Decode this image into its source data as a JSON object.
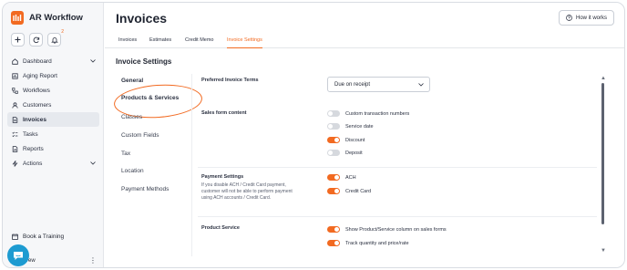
{
  "app": {
    "name": "AR Workflow",
    "notification_count": "2"
  },
  "sidebar": {
    "items": [
      {
        "label": "Dashboard",
        "icon": "home-icon",
        "expandable": true
      },
      {
        "label": "Aging Report",
        "icon": "report-icon"
      },
      {
        "label": "Workflows",
        "icon": "workflow-icon"
      },
      {
        "label": "Customers",
        "icon": "user-icon"
      },
      {
        "label": "Invoices",
        "icon": "document-icon",
        "active": true
      },
      {
        "label": "Tasks",
        "icon": "tasks-icon"
      },
      {
        "label": "Reports",
        "icon": "chart-icon"
      },
      {
        "label": "Actions",
        "icon": "bolt-icon",
        "expandable": true
      }
    ],
    "book_training": "Book a Training",
    "user_partial": "rew"
  },
  "header": {
    "title": "Invoices",
    "how_it_works": "How it works"
  },
  "tabs": [
    {
      "label": "Invoices"
    },
    {
      "label": "Estimates"
    },
    {
      "label": "Credit Memo"
    },
    {
      "label": "Invoice Settings",
      "active": true
    }
  ],
  "settings": {
    "title": "Invoice Settings",
    "subnav": [
      "General",
      "Products & Services",
      "Classes",
      "Custom Fields",
      "Tax",
      "Location",
      "Payment Methods"
    ],
    "preferred_terms_label": "Preferred Invoice Terms",
    "preferred_terms_value": "Due on receipt",
    "sales_form_label": "Sales form content",
    "sales_form_toggles": [
      {
        "label": "Custom transaction numbers",
        "on": false
      },
      {
        "label": "Service date",
        "on": false
      },
      {
        "label": "Discount",
        "on": true
      },
      {
        "label": "Deposit",
        "on": false
      }
    ],
    "payment_label": "Payment Settings",
    "payment_help": "If you disable ACH / Credit Card payment, customer will not be able to perform payment using ACH accounts / Credit Card.",
    "payment_toggles": [
      {
        "label": "ACH",
        "on": true
      },
      {
        "label": "Credit Card",
        "on": true
      }
    ],
    "product_service_label": "Product Service",
    "product_toggles": [
      {
        "label": "Show Product/Service column on sales forms",
        "on": true
      },
      {
        "label": "Track quantity and price/rate",
        "on": true
      }
    ]
  },
  "colors": {
    "accent": "#f26a21",
    "chat": "#1d9bd1"
  }
}
